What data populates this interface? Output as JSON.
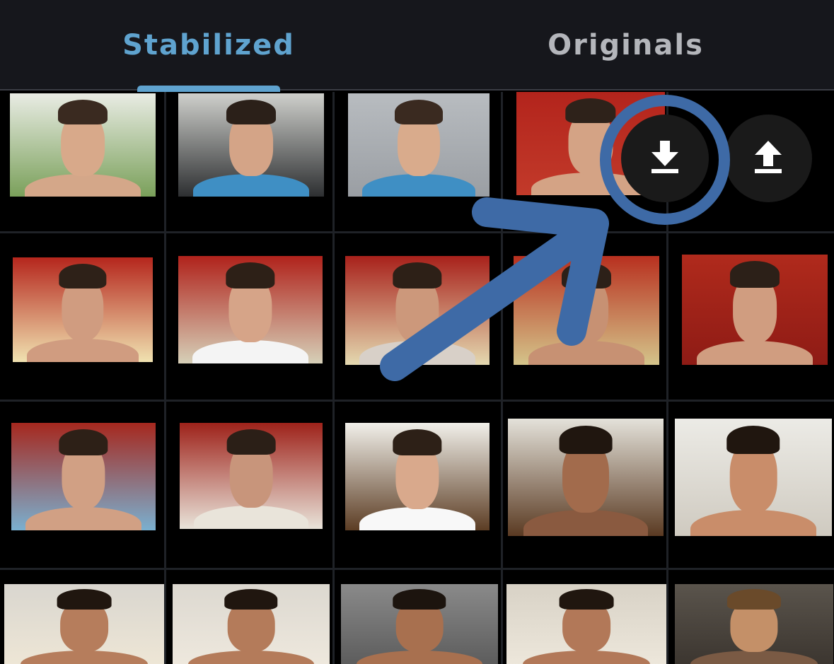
{
  "tabs": [
    {
      "label": "Stabilized",
      "active": true
    },
    {
      "label": "Originals",
      "active": false
    }
  ],
  "actions": {
    "download_icon": "download-icon",
    "upload_icon": "upload-icon"
  },
  "colors": {
    "tabbar_bg": "#16171c",
    "active_tab_text": "#5fa3cf",
    "inactive_tab_text": "#b4b6bb",
    "indicator": "#5fa3cf",
    "annotation": "#3e6aa6",
    "button_bg": "#1a1a1a",
    "icon": "#ffffff"
  },
  "photos": [
    {
      "bg": "#e9ece4",
      "wall": "#7aa05a",
      "skin": "#d8a98a",
      "hair": "#3a2a20",
      "shirt": "#d4a789"
    },
    {
      "bg": "#cfd0cc",
      "wall": "#2d2f31",
      "skin": "#d4a487",
      "hair": "#2b2019",
      "shirt": "#3f8fc4"
    },
    {
      "bg": "#b8bcc0",
      "wall": "#9a9ea3",
      "skin": "#d9ab8c",
      "hair": "#3a2a20",
      "shirt": "#3f8fc4"
    },
    {
      "bg": "#b3241c",
      "wall": "#c23a2a",
      "skin": "#d4a385",
      "hair": "#2e221a",
      "shirt": "#d4a385"
    },
    {
      "bg": "#b3241c",
      "wall": "#8a1d16",
      "skin": "#c89478",
      "hair": "#24190f",
      "shirt": "#e8e8e8"
    },
    {
      "bg": "#b5261c",
      "wall": "#f0e2b0",
      "skin": "#d09c80",
      "hair": "#2e2118",
      "shirt": "#d09c80"
    },
    {
      "bg": "#b0221b",
      "wall": "#d6d0b8",
      "skin": "#d6a488",
      "hair": "#2d2017",
      "shirt": "#f4f4f4"
    },
    {
      "bg": "#a8211b",
      "wall": "#e4d9b0",
      "skin": "#cc987b",
      "hair": "#2d2017",
      "shirt": "#d8d0c8"
    },
    {
      "bg": "#b8301f",
      "wall": "#d4c48a",
      "skin": "#c79173",
      "hair": "#2c2018",
      "shirt": "#c79173"
    },
    {
      "bg": "#b02a1c",
      "wall": "#8e1b15",
      "skin": "#d09d80",
      "hair": "#2c2018",
      "shirt": "#d09d80"
    },
    {
      "bg": "#a6281e",
      "wall": "#7ab0d0",
      "skin": "#d1a084",
      "hair": "#2d2017",
      "shirt": "#d1a084"
    },
    {
      "bg": "#9e221a",
      "wall": "#e9e4da",
      "skin": "#c8957b",
      "hair": "#2b1f17",
      "shirt": "#e9e4da"
    },
    {
      "bg": "#f1f0ea",
      "wall": "#5c3d24",
      "skin": "#d9a98c",
      "hair": "#2d2017",
      "shirt": "#f8f8f8"
    },
    {
      "bg": "#e4e2da",
      "wall": "#5a3a22",
      "skin": "#a26b4c",
      "hair": "#20160f",
      "shirt": "#8a5a40"
    },
    {
      "bg": "#ecebe6",
      "wall": "#cfcac0",
      "skin": "#c98d6a",
      "hair": "#20160f",
      "shirt": "#c98d6a"
    },
    {
      "bg": "#d9d6cf",
      "wall": "#efe7d6",
      "skin": "#b67d5c",
      "hair": "#20160f",
      "shirt": "#b67d5c"
    },
    {
      "bg": "#dcd8d0",
      "wall": "#efe9de",
      "skin": "#b47b5a",
      "hair": "#20160f",
      "shirt": "#b47b5a"
    },
    {
      "bg": "#8a8a8a",
      "wall": "#5a5a5a",
      "skin": "#a8704f",
      "hair": "#1c140e",
      "shirt": "#a8704f"
    },
    {
      "bg": "#d8d2c6",
      "wall": "#eee8dc",
      "skin": "#b27858",
      "hair": "#20160f",
      "shirt": "#b27858"
    },
    {
      "bg": "#5a544c",
      "wall": "#3a342e",
      "skin": "#c49068",
      "hair": "#6a4a2a",
      "shirt": "#7a5a44"
    }
  ]
}
